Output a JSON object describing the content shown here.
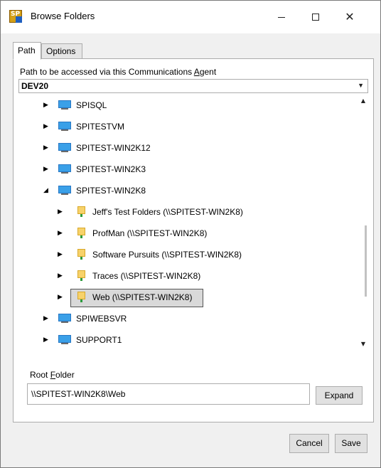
{
  "window": {
    "title": "Browse Folders",
    "app_icon_text": "SP",
    "minimize_glyph": "—",
    "maximize_glyph": "☐",
    "close_glyph": "✕"
  },
  "tabs": [
    {
      "label": "Path",
      "active": true
    },
    {
      "label": "Options",
      "active": false
    }
  ],
  "path_label": {
    "before": "Path to be accessed via this Communications ",
    "accel": "A",
    "after": "gent"
  },
  "agent_select": {
    "value": "DEV20",
    "arrow": "▼"
  },
  "tree": {
    "scroll_up": "▲",
    "scroll_down": "▼",
    "nodes": [
      {
        "label": "SPISQL",
        "type": "computer",
        "level": 0,
        "expander": "▶"
      },
      {
        "label": "SPITESTVM",
        "type": "computer",
        "level": 0,
        "expander": "▶"
      },
      {
        "label": "SPITEST-WIN2K12",
        "type": "computer",
        "level": 0,
        "expander": "▶"
      },
      {
        "label": "SPITEST-WIN2K3",
        "type": "computer",
        "level": 0,
        "expander": "▶"
      },
      {
        "label": "SPITEST-WIN2K8",
        "type": "computer",
        "level": 0,
        "expander": "◢"
      },
      {
        "label": "Jeff's Test Folders (\\\\SPITEST-WIN2K8)",
        "type": "share",
        "level": 1,
        "expander": "▶"
      },
      {
        "label": "ProfMan (\\\\SPITEST-WIN2K8)",
        "type": "share",
        "level": 1,
        "expander": "▶"
      },
      {
        "label": "Software Pursuits (\\\\SPITEST-WIN2K8)",
        "type": "share",
        "level": 1,
        "expander": "▶"
      },
      {
        "label": "Traces (\\\\SPITEST-WIN2K8)",
        "type": "share",
        "level": 1,
        "expander": "▶"
      },
      {
        "label": "Web (\\\\SPITEST-WIN2K8)",
        "type": "share",
        "level": 1,
        "expander": "▶",
        "selected": true
      },
      {
        "label": "SPIWEBSVR",
        "type": "computer",
        "level": 0,
        "expander": "▶"
      },
      {
        "label": "SUPPORT1",
        "type": "computer",
        "level": 0,
        "expander": "▶"
      }
    ]
  },
  "root_folder": {
    "label_before": "Root ",
    "label_accel": "F",
    "label_after": "older",
    "value": "\\\\SPITEST-WIN2K8\\Web",
    "expand_label": "Expand"
  },
  "buttons": {
    "cancel": "Cancel",
    "save": "Save"
  }
}
